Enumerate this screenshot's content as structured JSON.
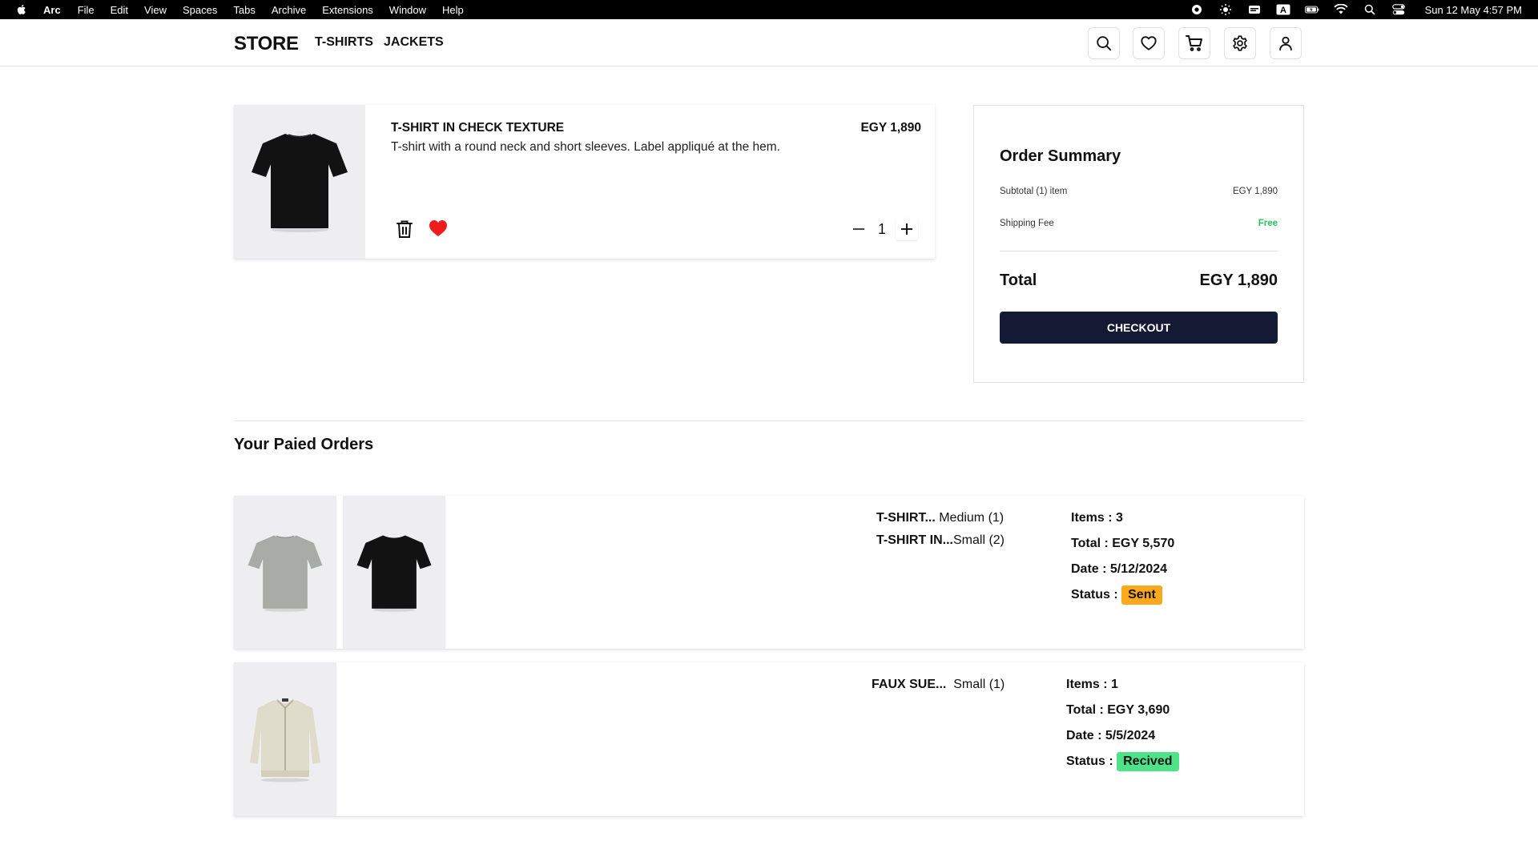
{
  "menubar": {
    "app": "Arc",
    "items": [
      "File",
      "Edit",
      "View",
      "Spaces",
      "Tabs",
      "Archive",
      "Extensions",
      "Window",
      "Help"
    ],
    "clock": "Sun 12 May  4:57 PM",
    "tray_icons": [
      "record-icon",
      "brightness-icon",
      "battery-status-icon",
      "keyboard-a-icon",
      "battery-icon",
      "wifi-icon",
      "spotlight-icon",
      "control-center-icon"
    ]
  },
  "nav": {
    "brand": "STORE",
    "links": [
      "T-SHIRTS",
      "JACKETS"
    ],
    "icons": [
      "search-icon",
      "heart-icon",
      "cart-icon",
      "gear-icon",
      "user-icon"
    ]
  },
  "cart": {
    "title": "T-SHIRT IN CHECK TEXTURE",
    "description": "T-shirt with a round neck and short sleeves. Label appliqué at the hem.",
    "price": "EGY 1,890",
    "quantity": "1",
    "favorite_color": "#ef1c1c"
  },
  "summary": {
    "title": "Order Summary",
    "subtotal_label": "Subtotal (1) item",
    "subtotal_value": "EGY 1,890",
    "shipping_label": "Shipping Fee",
    "shipping_value": "Free",
    "total_label": "Total",
    "total_value": "EGY 1,890",
    "checkout_label": "CHECKOUT",
    "accent_color": "#141a33"
  },
  "paid_orders": {
    "title": "Your Paied Orders",
    "orders": [
      {
        "lines": [
          {
            "name": "T-SHIRT...",
            "detail": " Medium (1)"
          },
          {
            "name": "T-SHIRT IN...",
            "detail": "Small (2)"
          }
        ],
        "items": "Items : 3",
        "total": "Total : EGY 5,570",
        "date": "Date : 5/12/2024",
        "status_label": "Status :",
        "status": "Sent",
        "status_color": "#f9a91a"
      },
      {
        "lines": [
          {
            "name": "FAUX SUE...",
            "detail": "  Small (1)"
          }
        ],
        "items": "Items : 1",
        "total": "Total : EGY 3,690",
        "date": "Date : 5/5/2024",
        "status_label": "Status :",
        "status": "Recived",
        "status_color": "#4ee389"
      }
    ]
  }
}
